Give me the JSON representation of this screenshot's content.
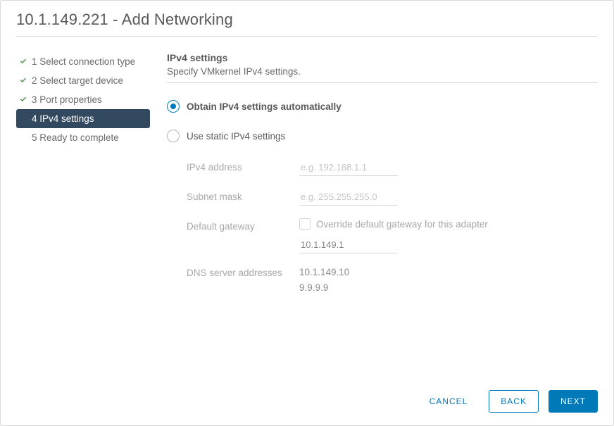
{
  "dialog": {
    "title": "10.1.149.221 - Add Networking"
  },
  "sidebar": {
    "steps": [
      {
        "label": "1 Select connection type",
        "state": "done"
      },
      {
        "label": "2 Select target device",
        "state": "done"
      },
      {
        "label": "3 Port properties",
        "state": "done"
      },
      {
        "label": "4 IPv4 settings",
        "state": "active"
      },
      {
        "label": "5 Ready to complete",
        "state": "pending"
      }
    ]
  },
  "panel": {
    "title": "IPv4 settings",
    "subtitle": "Specify VMkernel IPv4 settings."
  },
  "options": {
    "auto_label": "Obtain IPv4 settings automatically",
    "static_label": "Use static IPv4 settings",
    "selected": "auto"
  },
  "form": {
    "ipv4_address": {
      "label": "IPv4 address",
      "placeholder": "e.g. 192.168.1.1",
      "value": ""
    },
    "subnet_mask": {
      "label": "Subnet mask",
      "placeholder": "e.g. 255.255.255.0",
      "value": ""
    },
    "default_gateway": {
      "label": "Default gateway",
      "override_label": "Override default gateway for this adapter",
      "value": "10.1.149.1"
    },
    "dns": {
      "label": "DNS server addresses",
      "line1": "10.1.149.10",
      "line2": "9.9.9.9"
    }
  },
  "footer": {
    "cancel": "CANCEL",
    "back": "BACK",
    "next": "NEXT"
  }
}
